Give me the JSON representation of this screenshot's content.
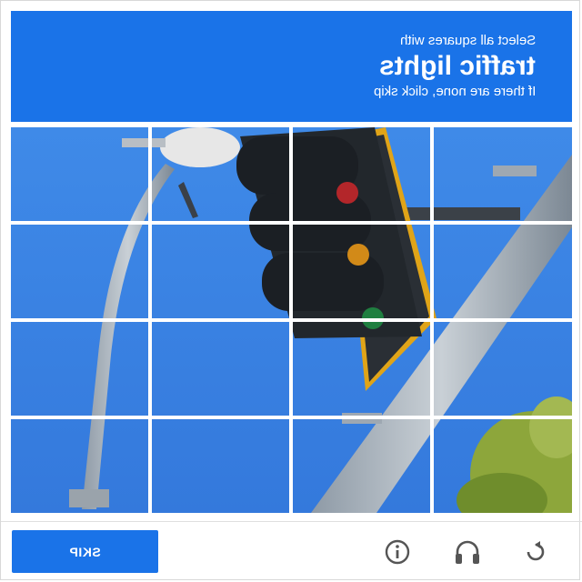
{
  "header": {
    "line1": "Select all squares with",
    "target": "traffic lights",
    "line3": "If there are none, click skip"
  },
  "footer": {
    "skip_label": "SKIP",
    "reload_icon": "reload-icon",
    "audio_icon": "headphones-icon",
    "info_icon": "info-icon"
  },
  "colors": {
    "accent": "#1a73e8",
    "sky": "#3d86e6"
  },
  "grid": {
    "rows": 4,
    "cols": 4
  }
}
